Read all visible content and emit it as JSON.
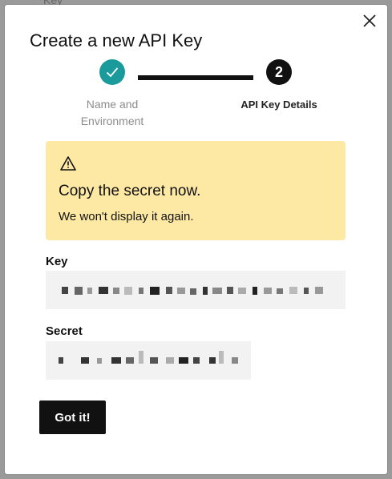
{
  "backdrop": {
    "partial_text": "Key"
  },
  "modal": {
    "title": "Create a new API Key",
    "close_icon": "close-icon"
  },
  "stepper": {
    "steps": [
      {
        "label": "Name and Environment",
        "state": "completed",
        "icon": "check-icon"
      },
      {
        "number": "2",
        "label": "API Key Details",
        "state": "active"
      }
    ],
    "colors": {
      "completed": "#1a9a9a",
      "active": "#111111"
    }
  },
  "alert": {
    "icon": "warning-icon",
    "heading": "Copy the secret now.",
    "body": "We won't display it again.",
    "background": "#fde9a3"
  },
  "key": {
    "label": "Key",
    "value_redacted": true
  },
  "secret": {
    "label": "Secret",
    "value_redacted": true
  },
  "actions": {
    "got_it": "Got it!"
  }
}
